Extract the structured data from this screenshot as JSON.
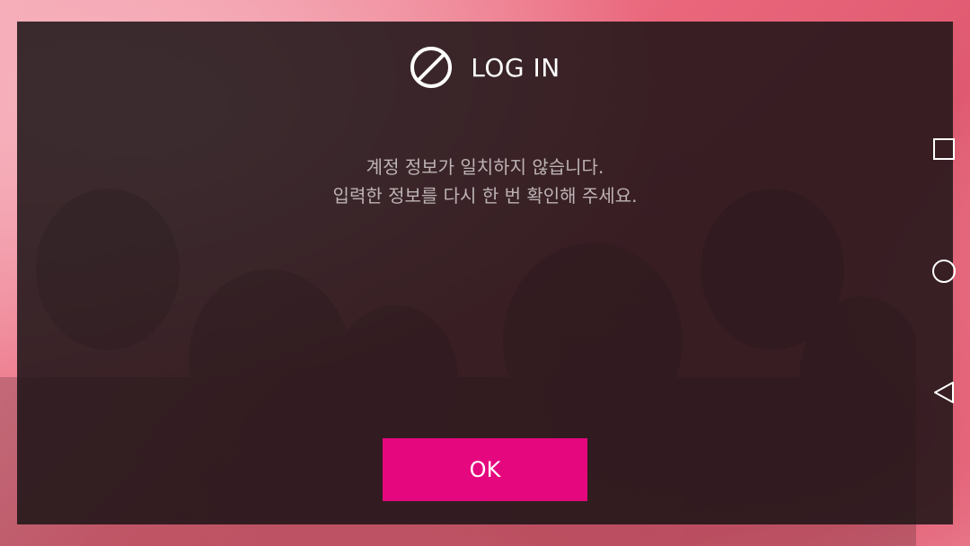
{
  "dialog": {
    "title": "LOG IN",
    "header_icon": "prohibited-icon",
    "message_lines": [
      "계정 정보가 일치하지 않습니다.",
      "입력한 정보를 다시 한 번 확인해 주세요."
    ],
    "ok_label": "OK"
  },
  "colors": {
    "accent": "#e5077e",
    "dialog_bg": "#1c1416",
    "message_text": "#bdb3b5",
    "background_pink": "#e9667b"
  },
  "nav_bar": {
    "buttons": [
      "recent-apps-icon",
      "home-icon",
      "back-icon"
    ]
  }
}
